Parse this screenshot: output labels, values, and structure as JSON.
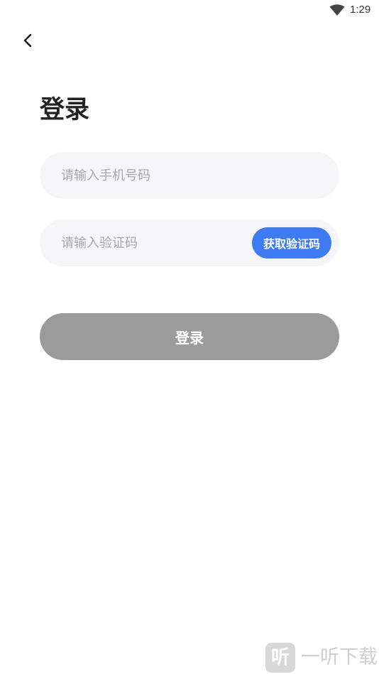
{
  "status_bar": {
    "time": "1:29",
    "wifi_icon": "wifi-icon"
  },
  "header": {
    "back_icon": "chevron-left-icon"
  },
  "page": {
    "title": "登录"
  },
  "form": {
    "phone": {
      "value": "",
      "placeholder": "请输入手机号码"
    },
    "code": {
      "value": "",
      "placeholder": "请输入验证码"
    },
    "get_code_label": "获取验证码",
    "login_label": "登录"
  },
  "watermark": {
    "logo_char": "听",
    "text": "一听下载"
  },
  "colors": {
    "accent": "#3d7bf5",
    "login_disabled": "#9b9b9b",
    "field_background": "#f6f6f8",
    "placeholder": "#a8a8ac"
  }
}
